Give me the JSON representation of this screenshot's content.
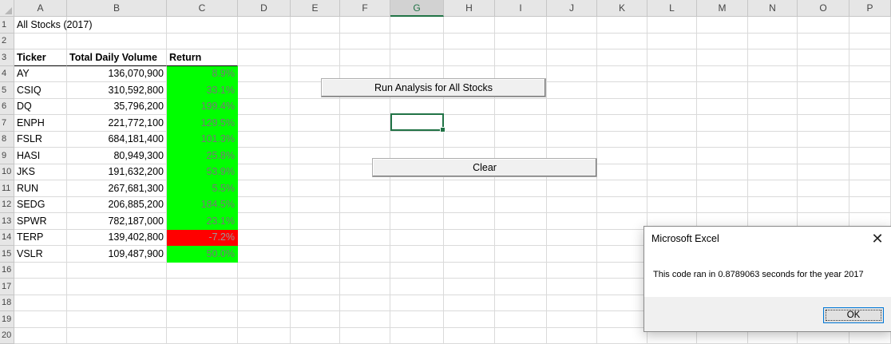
{
  "columns": [
    "A",
    "B",
    "C",
    "D",
    "E",
    "F",
    "G",
    "H",
    "I",
    "J",
    "K",
    "L",
    "M",
    "N",
    "O",
    "P"
  ],
  "selected_column": "G",
  "rows": [
    "1",
    "2",
    "3",
    "4",
    "5",
    "6",
    "7",
    "8",
    "9",
    "10",
    "11",
    "12",
    "13",
    "14",
    "15",
    "16",
    "17",
    "18",
    "19",
    "20"
  ],
  "title_cell": "All Stocks (2017)",
  "headers": {
    "ticker": "Ticker",
    "volume": "Total Daily Volume",
    "return": "Return"
  },
  "stocks": [
    {
      "ticker": "AY",
      "volume": "136,070,900",
      "return": "8.9%",
      "positive": true
    },
    {
      "ticker": "CSIQ",
      "volume": "310,592,800",
      "return": "33.1%",
      "positive": true
    },
    {
      "ticker": "DQ",
      "volume": "35,796,200",
      "return": "199.4%",
      "positive": true
    },
    {
      "ticker": "ENPH",
      "volume": "221,772,100",
      "return": "129.5%",
      "positive": true
    },
    {
      "ticker": "FSLR",
      "volume": "684,181,400",
      "return": "101.3%",
      "positive": true
    },
    {
      "ticker": "HASI",
      "volume": "80,949,300",
      "return": "25.8%",
      "positive": true
    },
    {
      "ticker": "JKS",
      "volume": "191,632,200",
      "return": "53.9%",
      "positive": true
    },
    {
      "ticker": "RUN",
      "volume": "267,681,300",
      "return": "5.5%",
      "positive": true
    },
    {
      "ticker": "SEDG",
      "volume": "206,885,200",
      "return": "184.5%",
      "positive": true
    },
    {
      "ticker": "SPWR",
      "volume": "782,187,000",
      "return": "23.1%",
      "positive": true
    },
    {
      "ticker": "TERP",
      "volume": "139,402,800",
      "return": "-7.2%",
      "positive": false
    },
    {
      "ticker": "VSLR",
      "volume": "109,487,900",
      "return": "50.0%",
      "positive": true
    }
  ],
  "buttons": {
    "run_analysis": "Run Analysis for All Stocks",
    "clear": "Clear"
  },
  "dialog": {
    "title": "Microsoft Excel",
    "message": "This code ran in 0.8789063 seconds for the year 2017",
    "ok": "OK",
    "close_glyph": "✕"
  },
  "colors": {
    "positive": "#00ff00",
    "negative": "#ff0000",
    "excel_green": "#217346"
  }
}
